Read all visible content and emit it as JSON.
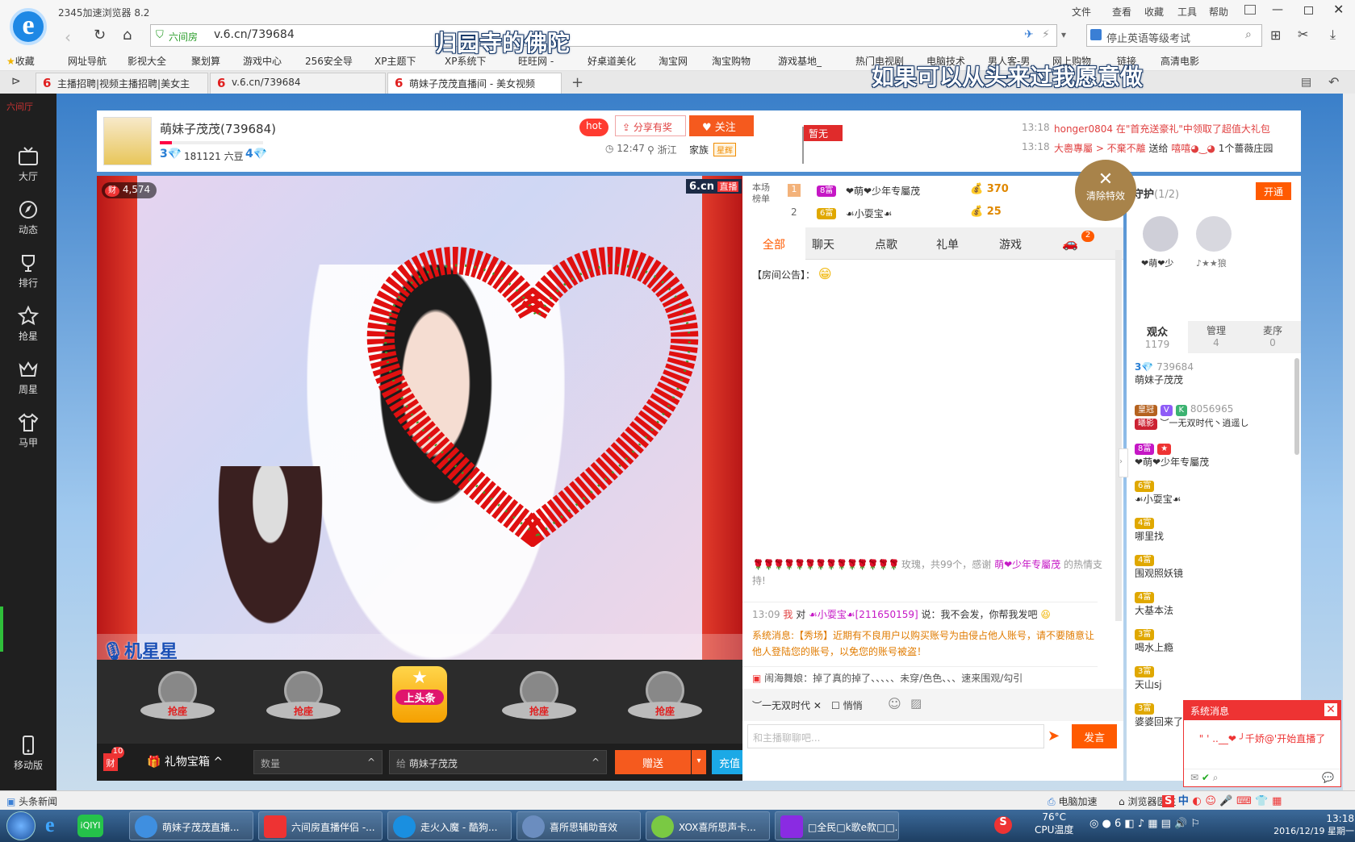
{
  "browser": {
    "app_title": "2345加速浏览器 8.2",
    "menu": [
      "文件",
      "查看",
      "收藏",
      "工具",
      "帮助"
    ],
    "url_site_label": "六间房",
    "url": "v.6.cn/739684",
    "search_placeholder": "停止英语等级考试",
    "favorites": [
      "收藏",
      "网址导航",
      "影视大全",
      "聚划算",
      "游戏中心",
      "256安全导",
      "XP主题下",
      "XP系统下",
      "旺旺网 -",
      "好桌道美化",
      "淘宝网",
      "淘宝购物",
      "游戏基地_",
      "热门电视剧",
      "电脑技术",
      "男人客-男",
      "网上购物",
      "链接",
      "高清电影"
    ],
    "tabs": [
      "主播招聘|视频主播招聘|美女主",
      "v.6.cn/739684",
      "萌妹子茂茂直播间 - 美女视频"
    ],
    "overlay_caption_1": "归园寺的佛陀",
    "overlay_caption_2": "如果可以从头来过我愿意做"
  },
  "leftnav": {
    "top_label": "六间厅",
    "items": [
      "大厅",
      "动态",
      "排行",
      "抢星",
      "周星",
      "马甲"
    ],
    "mobile": "移动版"
  },
  "host": {
    "name": "萌妹子茂茂(739684)",
    "level_left": "3",
    "beans": "181121 六豆",
    "level_right": "4",
    "hot": "hot",
    "share": "分享有奖",
    "follow": "关注",
    "time": "12:47",
    "location": "浙江",
    "family_label": "家族",
    "family_badge": "星辉",
    "flag": "暂无"
  },
  "feed": [
    {
      "time": "13:18",
      "text": "honger0804 在\"首充送豪礼\"中领取了超值大礼包"
    },
    {
      "time": "13:18",
      "user": "大嶴專屬 > 不棄不離",
      "mid": "送给",
      "target": "嘻嘻◕‿◕",
      "gift": "1个薔薇庄园"
    }
  ],
  "video": {
    "wealth": "4,574",
    "brand": "6.cn",
    "live": "直播",
    "mic_name": "机星星",
    "seat_label": "抢座",
    "headline": "上头条"
  },
  "giftbar": {
    "badge_count": "10",
    "badge_label": "财",
    "gift_box": "礼物宝箱",
    "qty_placeholder": "数量",
    "to_label": "给",
    "to_name": "萌妹子茂茂",
    "send": "赠送",
    "recharge": "充值"
  },
  "ranking": {
    "label": "本场榜单",
    "rows": [
      {
        "rank": "1",
        "name": "❤萌❤少年专屬茂",
        "score": "370"
      },
      {
        "rank": "2",
        "name": "☙小耍宝☙",
        "score": "25"
      }
    ],
    "clear_effects": "清除特效"
  },
  "chat_tabs": [
    "全部",
    "聊天",
    "点歌",
    "礼单",
    "游戏"
  ],
  "chat_tab_badge": "2",
  "chat": {
    "notice": "【房间公告】：",
    "gift_line": "玫瑰，共99个，感谢",
    "gift_line_user": "萌❤少年专屬茂",
    "gift_line_end": "的热情支持!",
    "msg_time": "13:09",
    "msg_from": "我",
    "msg_mid": "对",
    "msg_to": "☙小耍宝☙[211650159]",
    "msg_text": "说：我不会发，你帮我发吧",
    "system_text": "系统消息:【秀场】近期有不良用户以购买账号为由侵占他人账号，请不要随意让他人登陆您的账号，以免您的账号被盗！",
    "ticker": "闹海舞娘：掉了真的掉了、、、、、未穿/色色、、、速来围观/勾引",
    "target_select": "︶一无双时代",
    "whisper": "悄悄",
    "input_placeholder": "和主播聊聊吧...",
    "send": "发言"
  },
  "guard": {
    "title": "守护",
    "count": "(1/2)",
    "open": "开通",
    "members": [
      "❤萌❤少",
      "♪★★狼"
    ]
  },
  "audience_tabs": [
    {
      "label": "观众",
      "count": "1179"
    },
    {
      "label": "管理",
      "count": "4"
    },
    {
      "label": "麦序",
      "count": "0"
    }
  ],
  "audience": [
    {
      "id": "739684",
      "name": "萌妹子茂茂",
      "level": "3"
    },
    {
      "id": "8056965",
      "name": "︶一无双时代丶逍遥し",
      "level": "皇冠",
      "tag": "曦影"
    },
    {
      "name": "❤萌❤少年专屬茂",
      "level": "8富"
    },
    {
      "name": "☙小耍宝☙",
      "level": "6富"
    },
    {
      "name": "哪里找",
      "level": "4富"
    },
    {
      "name": "围观照妖镜",
      "level": "4富"
    },
    {
      "name": "大基本法",
      "level": "4富"
    },
    {
      "name": "喝水上瘾",
      "level": "3富"
    },
    {
      "name": "天山sj",
      "level": "3富"
    },
    {
      "name": "婆婆回来了",
      "level": "3富"
    }
  ],
  "popup": {
    "title": "系统消息",
    "text": "\"  ' ..__❤ ╯千娇@'开始直播了"
  },
  "statusbar": {
    "left": "头条新闻",
    "accel": "电脑加速",
    "doctor": "浏览器医生"
  },
  "taskbar": {
    "tasks": [
      "萌妹子茂茂直播...",
      "六间房直播伴侣 -...",
      "走火入魔 - 酷狗...",
      "喜所思辅助音效",
      "XOX喜所思声卡...",
      "□全民□k歌e款□□..."
    ],
    "temp": "76°C",
    "temp_label": "CPU温度",
    "ime": "中",
    "time": "13:18",
    "date": "2016/12/19 星期一"
  },
  "colors": {
    "accent_orange": "#ff5a00",
    "brand_red": "#e52b2b",
    "nav_dark": "#1f1f1f",
    "taskbar": "#1d3e62"
  }
}
